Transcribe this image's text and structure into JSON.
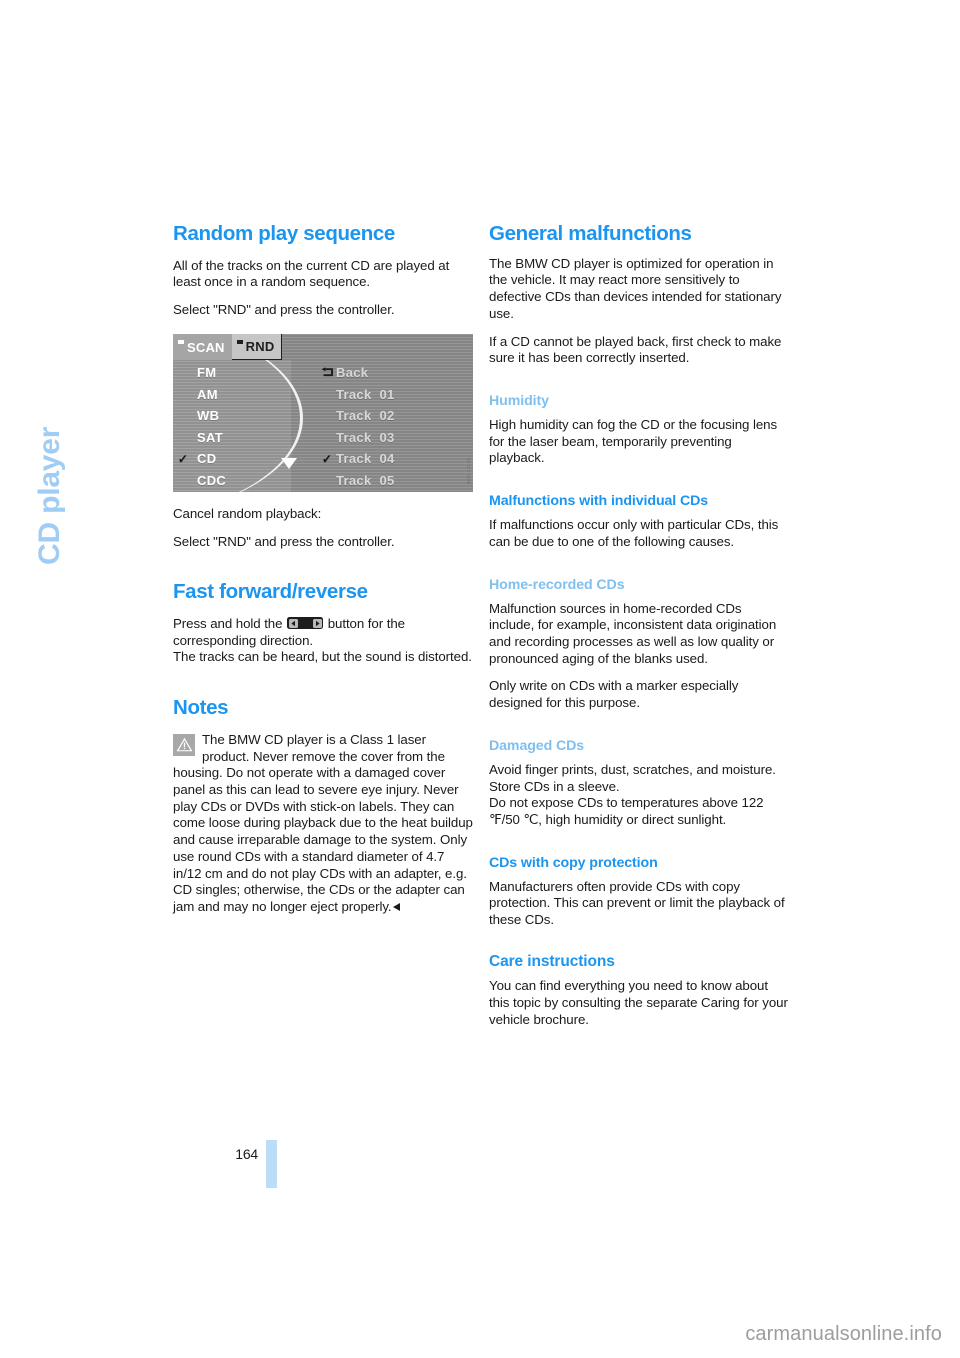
{
  "chapter": {
    "title": "CD player"
  },
  "page": {
    "number": "164"
  },
  "watermark": {
    "text": "carmanualsonline.info"
  },
  "left_column": {
    "random_play": {
      "heading": "Random play sequence",
      "p1": "All of the tracks on the current CD are played at least once in a random sequence.",
      "p2": "Select \"RND\" and press the controller.",
      "p3": "Cancel random playback:",
      "p4": "Select \"RND\" and press the controller."
    },
    "fast_forward": {
      "heading": "Fast forward/reverse",
      "p1_before": "Press and hold the",
      "p1_after": "button for the corresponding direction.",
      "p2": "The tracks can be heard, but the sound is distorted."
    },
    "notes": {
      "heading": "Notes",
      "warning_text": "The BMW CD player is a Class 1 laser product. Never remove the cover from the housing. Do not operate with a damaged cover panel as this can lead to severe eye injury. Never play CDs or DVDs with stick-on labels. They can come loose during playback due to the heat buildup and cause irreparable damage to the system. Only use round CDs with a standard diameter of 4.7 in/12 cm and do not play CDs with an adapter, e.g. CD singles; otherwise, the CDs or the adapter can jam and may no longer eject properly."
    }
  },
  "right_column": {
    "general_malfunctions": {
      "heading": "General malfunctions",
      "p1": "The BMW CD player is optimized for operation in the vehicle. It may react more sensitively to defective CDs than devices intended for stationary use.",
      "p2": "If a CD cannot be played back, first check to make sure it has been correctly inserted."
    },
    "humidity": {
      "heading": "Humidity",
      "p1": "High humidity can fog the CD or the focusing lens for the laser beam, temporarily preventing playback."
    },
    "malfunctions_individual": {
      "heading": "Malfunctions with individual CDs",
      "p1": "If malfunctions occur only with particular CDs, this can be due to one of the following causes."
    },
    "home_recorded": {
      "heading": "Home-recorded CDs",
      "p1": "Malfunction sources in home-recorded CDs include, for example, inconsistent data origination and recording processes as well as low quality or pronounced aging of the blanks used.",
      "p2": "Only write on CDs with a marker especially designed for this purpose."
    },
    "damaged": {
      "heading": "Damaged CDs",
      "p1": "Avoid finger prints, dust, scratches, and moisture.",
      "p2": "Store CDs in a sleeve.",
      "p3": "Do not expose CDs to temperatures above 122 ℉/50 ℃, high humidity or direct sunlight."
    },
    "copy_protection": {
      "heading": "CDs with copy protection",
      "p1": "Manufacturers often provide CDs with copy protection. This can prevent or limit the playback of these CDs."
    },
    "care": {
      "heading": "Care instructions",
      "p1": "You can find everything you need to know about this topic by consulting the separate Caring for your vehicle brochure."
    }
  },
  "figure": {
    "tabs": [
      {
        "label": "SCAN",
        "active": false
      },
      {
        "label": "RND",
        "active": true
      }
    ],
    "menu": [
      {
        "label": "FM",
        "checked": false
      },
      {
        "label": "AM",
        "checked": false
      },
      {
        "label": "WB",
        "checked": false
      },
      {
        "label": "SAT",
        "checked": false
      },
      {
        "label": "CD",
        "checked": true
      },
      {
        "label": "CDC",
        "checked": false
      }
    ],
    "tracks": [
      {
        "label": "Back",
        "num": "",
        "checked": false,
        "back": true
      },
      {
        "label": "Track",
        "num": "01",
        "checked": false,
        "back": false
      },
      {
        "label": "Track",
        "num": "02",
        "checked": false,
        "back": false
      },
      {
        "label": "Track",
        "num": "03",
        "checked": false,
        "back": false
      },
      {
        "label": "Track",
        "num": "04",
        "checked": true,
        "back": false
      },
      {
        "label": "Track",
        "num": "05",
        "checked": false,
        "back": false
      }
    ],
    "code": "RND CD 01"
  },
  "colors": {
    "heading_blue": "#1b95ef",
    "sub_blue": "#7fc0ef",
    "chapter_blue": "#9fcdf5",
    "page_bar": "#bbddf8",
    "text": "#1a1a1a"
  }
}
